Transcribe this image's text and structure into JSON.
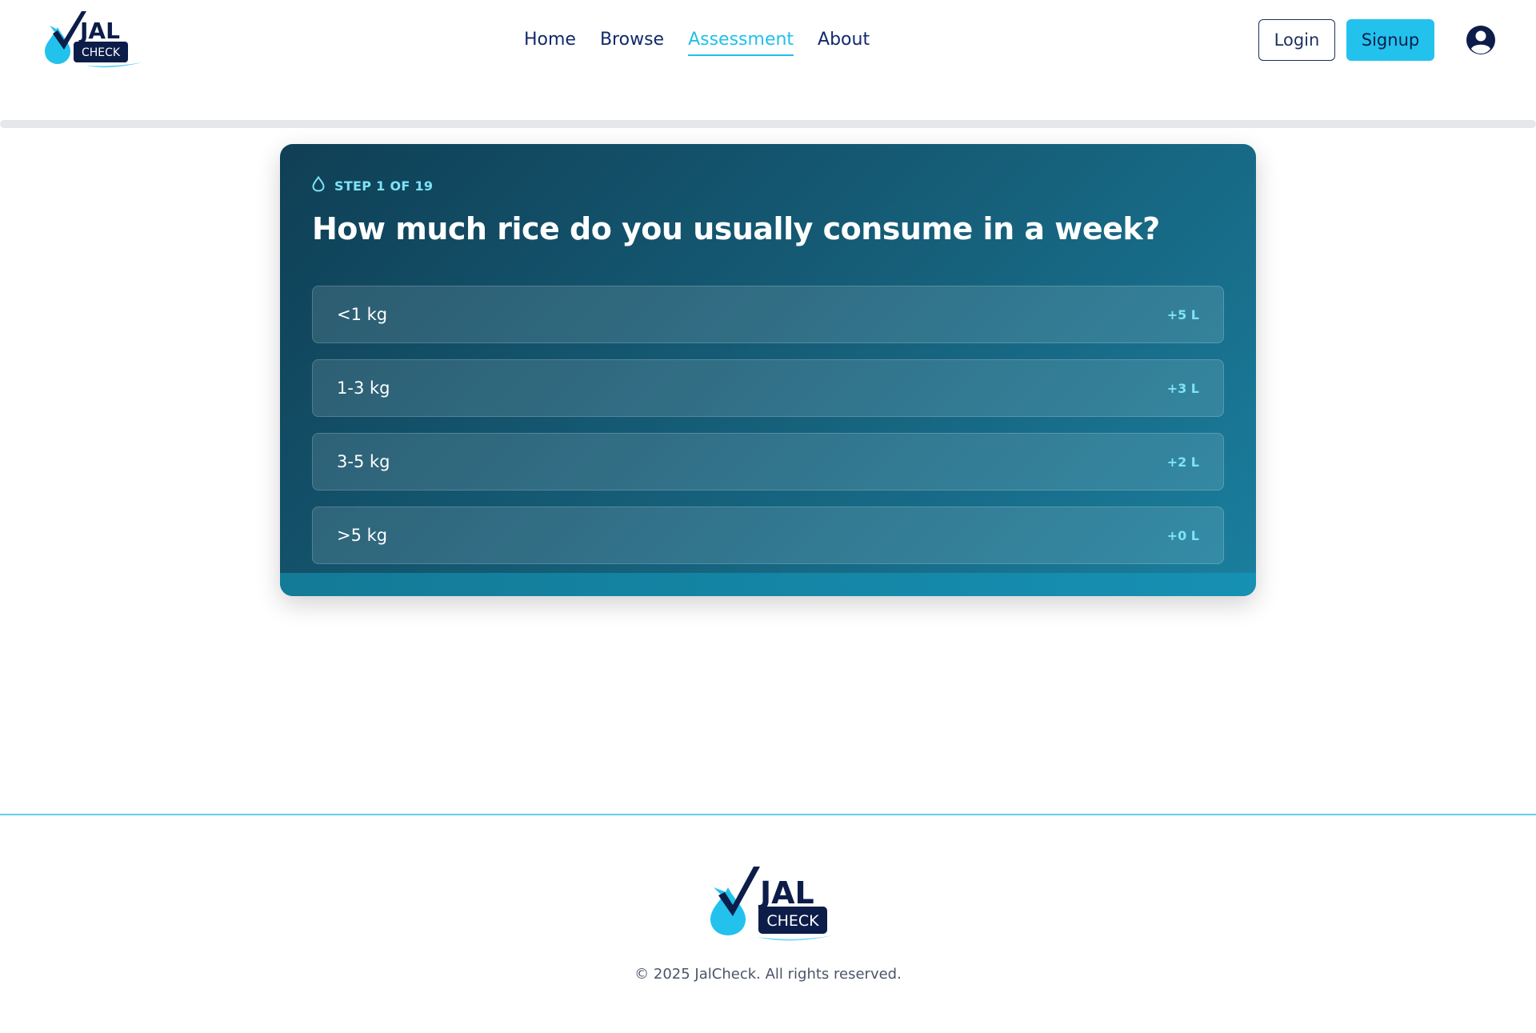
{
  "brand": {
    "logo_top": "JAL",
    "logo_bottom": "CHECK",
    "colors": {
      "navy": "#0d1d4a",
      "cyan": "#22c2ed"
    }
  },
  "nav": {
    "items": [
      {
        "label": "Home",
        "active": false
      },
      {
        "label": "Browse",
        "active": false
      },
      {
        "label": "Assessment",
        "active": true
      },
      {
        "label": "About",
        "active": false
      }
    ]
  },
  "auth": {
    "login_label": "Login",
    "signup_label": "Signup",
    "user_icon": "user-circle-icon"
  },
  "progress": {
    "fraction": 0
  },
  "card": {
    "step_icon": "water-drop-icon",
    "step_label": "STEP 1 OF 19",
    "question": "How much rice do you usually consume in a week?",
    "options": [
      {
        "label": "<1 kg",
        "value": "+5 L"
      },
      {
        "label": "1-3 kg",
        "value": "+3 L"
      },
      {
        "label": "3-5 kg",
        "value": "+2 L"
      },
      {
        "label": ">5 kg",
        "value": "+0 L"
      }
    ]
  },
  "footer": {
    "copyright": "© 2025 JalCheck. All rights reserved."
  }
}
